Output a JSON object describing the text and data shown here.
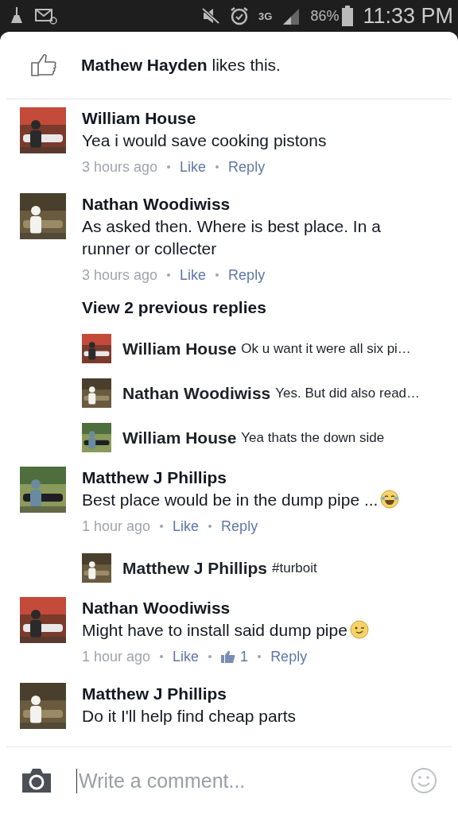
{
  "status_bar": {
    "network": "3G",
    "battery": "86%",
    "time": "11:33 PM"
  },
  "likes": {
    "text": "**Mathew Hayden** likes this."
  },
  "comments": [
    {
      "author": "William House",
      "text": "Yea i would save cooking pistons",
      "time": "3 hours ago",
      "like": "Like",
      "reply": "Reply"
    },
    {
      "author": "Nathan Woodiwiss",
      "text": "As asked then. Where is best place. In a runner or collecter",
      "time": "3 hours ago",
      "like": "Like",
      "reply": "Reply",
      "view_replies": "View 2 previous replies",
      "replies": [
        {
          "author": "William House",
          "text": "Ok u want it were all six pi…"
        },
        {
          "author": "Nathan Woodiwiss",
          "text": "Yes. But did also read…"
        },
        {
          "author": "William House",
          "text": "Yea thats the down side"
        }
      ]
    },
    {
      "author": "Matthew J Phillips",
      "text": "Best place would be in the dump pipe ...",
      "laughing_emoji": true,
      "time": "1 hour ago",
      "like": "Like",
      "reply": "Reply",
      "replies": [
        {
          "author": "Matthew J Phillips",
          "text": "#turboit"
        }
      ]
    },
    {
      "author": "Nathan Woodiwiss",
      "text": "Might have to install said dump pipe",
      "winking_emoji": true,
      "time": "1 hour ago",
      "like": "Like",
      "like_count": "1",
      "reply": "Reply"
    },
    {
      "author": "Matthew J Phillips",
      "text": "Do it I'll help find cheap parts"
    }
  ],
  "composer": {
    "placeholder": "Write a comment..."
  }
}
